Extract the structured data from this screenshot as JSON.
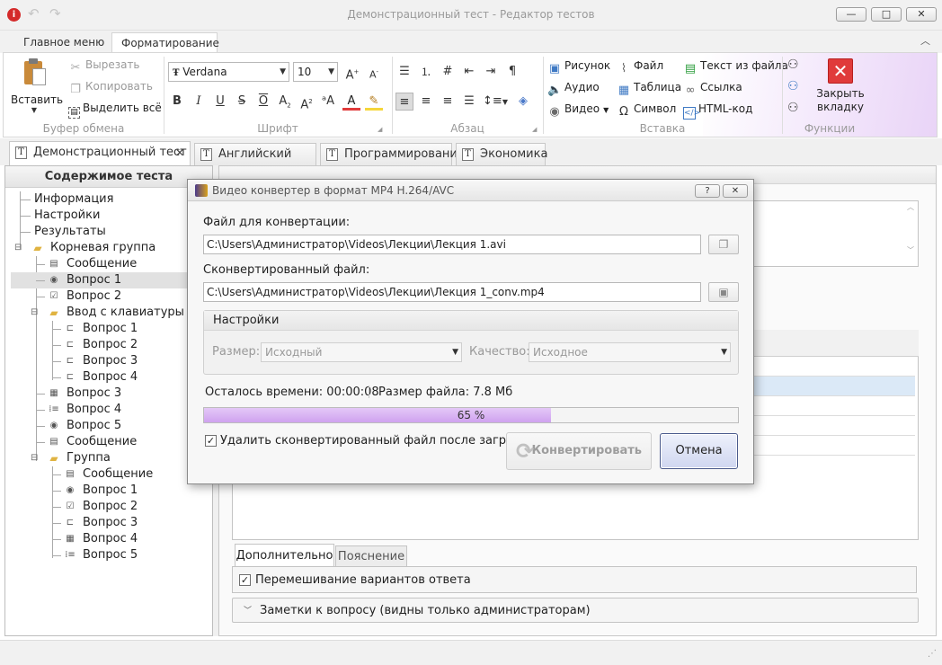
{
  "window": {
    "title": "Демонстрационный тест - Редактор тестов",
    "minimize": "—",
    "maximize": "□",
    "close": "✕"
  },
  "ribbon_tabs": [
    "Главное меню",
    "Форматирование"
  ],
  "ribbon": {
    "clipboard": {
      "label": "Буфер обмена",
      "paste": "Вставить",
      "cut": "Вырезать",
      "copy": "Копировать",
      "select_all": "Выделить всё"
    },
    "font": {
      "label": "Шрифт",
      "family": "Verdana",
      "size": "10"
    },
    "paragraph": {
      "label": "Абзац"
    },
    "insert": {
      "label": "Вставка",
      "picture": "Рисунок",
      "audio": "Аудио",
      "video": "Видео",
      "file": "Файл",
      "table": "Таблица",
      "symbol": "Символ",
      "text_from_file": "Текст из файла",
      "link": "Ссылка",
      "html_code": "HTML-код"
    },
    "functions": {
      "label": "Функции",
      "close_tab": "Закрыть вкладку"
    }
  },
  "doc_tabs": [
    "Демонстрационный тест",
    "Английский язык",
    "Программирование",
    "Экономика"
  ],
  "tree": {
    "header": "Содержимое теста",
    "items": [
      {
        "label": "Информация"
      },
      {
        "label": "Настройки"
      },
      {
        "label": "Результаты"
      },
      {
        "label": "Корневая группа"
      },
      {
        "label": "Сообщение"
      },
      {
        "label": "Вопрос 1"
      },
      {
        "label": "Вопрос 2"
      },
      {
        "label": "Ввод с клавиатуры"
      },
      {
        "label": "Вопрос 1"
      },
      {
        "label": "Вопрос 2"
      },
      {
        "label": "Вопрос 3"
      },
      {
        "label": "Вопрос 4"
      },
      {
        "label": "Вопрос 3"
      },
      {
        "label": "Вопрос 4"
      },
      {
        "label": "Вопрос 5"
      },
      {
        "label": "Сообщение"
      },
      {
        "label": "Группа"
      },
      {
        "label": "Сообщение"
      },
      {
        "label": "Вопрос 1"
      },
      {
        "label": "Вопрос 2"
      },
      {
        "label": "Вопрос 3"
      },
      {
        "label": "Вопрос 4"
      },
      {
        "label": "Вопрос 5"
      }
    ]
  },
  "question_panel": {
    "tabs": [
      "Дополнительно",
      "Пояснение"
    ],
    "shuffle": "Перемешивание вариантов ответа",
    "notes": "Заметки к вопросу (видны только администраторам)"
  },
  "dialog": {
    "title": "Видео конвертер в формат MP4 H.264/AVC",
    "help": "?",
    "close": "✕",
    "source_label": "Файл для конвертации:",
    "source_value": "C:\\Users\\Администратор\\Videos\\Лекции\\Лекция 1.avi",
    "target_label": "Сконвертированный файл:",
    "target_value": "C:\\Users\\Администратор\\Videos\\Лекции\\Лекция 1_conv.mp4",
    "settings_label": "Настройки",
    "size_label": "Размер:",
    "size_value": "Исходный",
    "quality_label": "Качество:",
    "quality_value": "Исходное",
    "time_left": "Осталось времени: 00:00:08",
    "file_size": "Размер файла: 7.8 Мб",
    "progress": 65,
    "progress_text": "65 %",
    "delete_checkbox": "Удалить сконвертированный файл после загрузки",
    "convert_button": "Конвертировать",
    "cancel_button": "Отмена"
  },
  "colors": {
    "accent": "#c9a3e8",
    "progress_fill": "#d9b6f2",
    "close_icon": "#e03b3b"
  }
}
